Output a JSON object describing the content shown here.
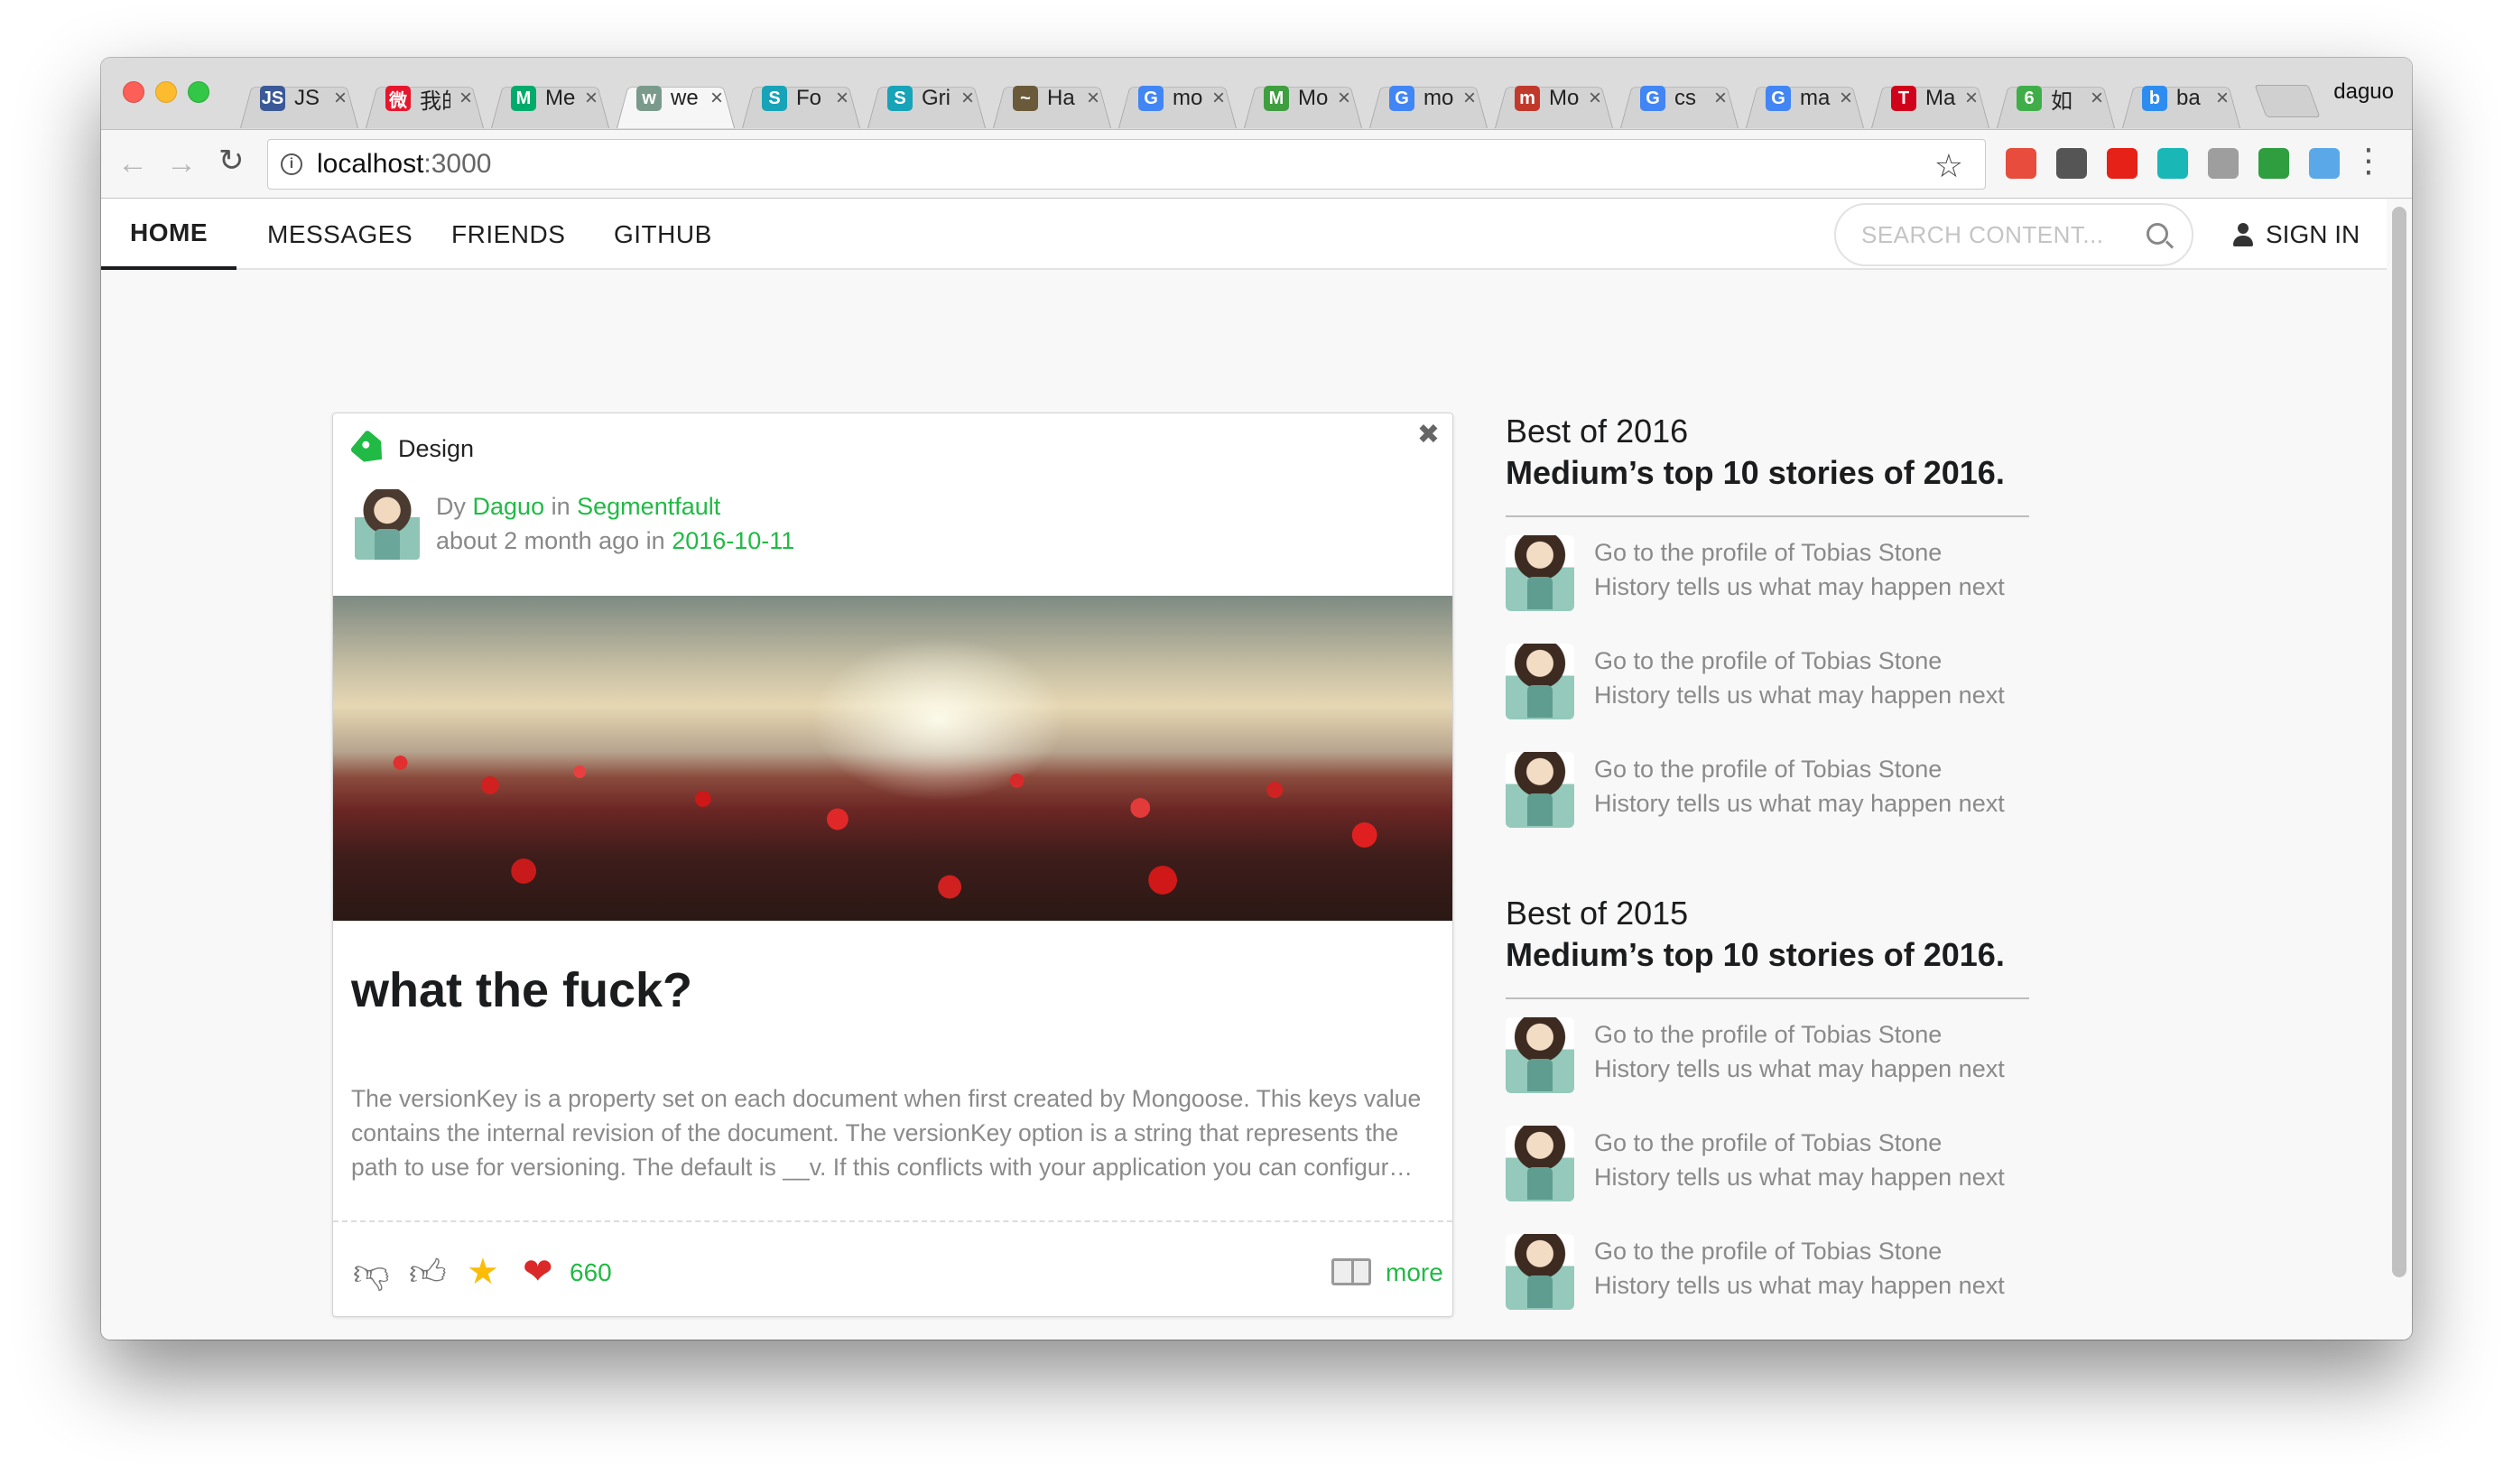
{
  "browser": {
    "tabs": [
      {
        "title": "JS",
        "fav_color": "#3b5998",
        "fav_text": "JS"
      },
      {
        "title": "我的",
        "fav_color": "#e6162d",
        "fav_text": "微"
      },
      {
        "title": "Me",
        "fav_color": "#00ab6b",
        "fav_text": "M"
      },
      {
        "title": "we",
        "fav_color": "#7a9a8c",
        "fav_text": "w"
      },
      {
        "title": "Fo",
        "fav_color": "#17a3b8",
        "fav_text": "S"
      },
      {
        "title": "Gri",
        "fav_color": "#17a3b8",
        "fav_text": "S"
      },
      {
        "title": "Ha",
        "fav_color": "#6b5a3a",
        "fav_text": "~"
      },
      {
        "title": "mo",
        "fav_color": "#4285f4",
        "fav_text": "G"
      },
      {
        "title": "Mo",
        "fav_color": "#3f9e3f",
        "fav_text": "M"
      },
      {
        "title": "mo",
        "fav_color": "#4285f4",
        "fav_text": "G"
      },
      {
        "title": "Mo",
        "fav_color": "#c0392b",
        "fav_text": "m"
      },
      {
        "title": "cs",
        "fav_color": "#4285f4",
        "fav_text": "G"
      },
      {
        "title": "ma",
        "fav_color": "#4285f4",
        "fav_text": "G"
      },
      {
        "title": "Ma",
        "fav_color": "#d0021b",
        "fav_text": "T"
      },
      {
        "title": "如",
        "fav_color": "#3fae49",
        "fav_text": "6"
      },
      {
        "title": "ba",
        "fav_color": "#2d8cf0",
        "fav_text": "b"
      }
    ],
    "active_tab_index": 3,
    "profile_name": "daguo",
    "url_host": "localhost",
    "url_port": ":3000",
    "extension_colors": [
      "#e74c3c",
      "#555555",
      "#e62117",
      "#1ab7b7",
      "#9e9e9e",
      "#2e9e3e",
      "#5aa8e8"
    ]
  },
  "nav": {
    "home": "HOME",
    "messages": "MESSAGES",
    "friends": "FRIENDS",
    "github": "GITHUB",
    "search_placeholder": "SEARCH CONTENT...",
    "sign_in": "SIGN IN"
  },
  "card": {
    "tag": "Design",
    "by_prefix": "Dy",
    "author": "Daguo",
    "in_word": "in",
    "publication": "Segmentfault",
    "time_prefix": "about 2 month ago in",
    "date": "2016-10-11",
    "title": "what the fuck?",
    "description": "The versionKey is a property set on each document when first created by Mongoose. This keys value contains the internal revision of the document. The versionKey option is a string that represents the path to use for versioning. The default is __v. If this conflicts with your application you can configur…",
    "likes": "660",
    "more": "more"
  },
  "sidebar": {
    "sections": [
      {
        "title": "Best of 2016",
        "subtitle": "Medium’s top 10 stories of 2016.",
        "items": [
          {
            "line1": "Go to the profile of Tobias Stone",
            "line2": "History tells us what may happen next"
          },
          {
            "line1": "Go to the profile of Tobias Stone",
            "line2": "History tells us what may happen next"
          },
          {
            "line1": "Go to the profile of Tobias Stone",
            "line2": "History tells us what may happen next"
          }
        ]
      },
      {
        "title": "Best of 2015",
        "subtitle": "Medium’s top 10 stories of 2016.",
        "items": [
          {
            "line1": "Go to the profile of Tobias Stone",
            "line2": "History tells us what may happen next"
          },
          {
            "line1": "Go to the profile of Tobias Stone",
            "line2": "History tells us what may happen next"
          },
          {
            "line1": "Go to the profile of Tobias Stone",
            "line2": "History tells us what may happen next"
          }
        ]
      }
    ]
  }
}
